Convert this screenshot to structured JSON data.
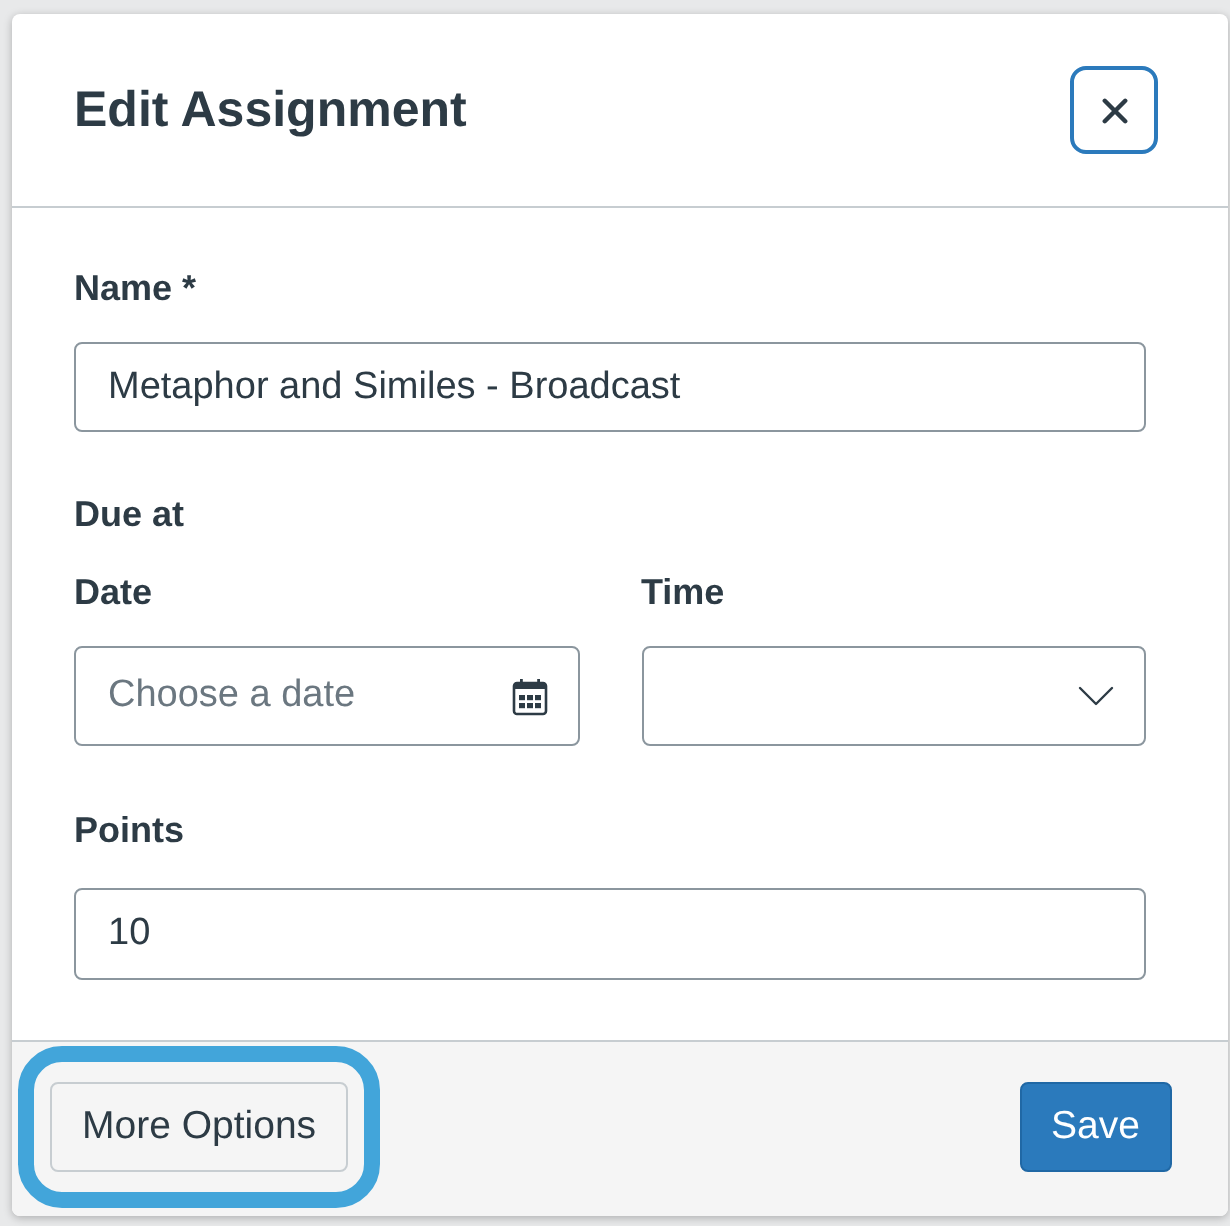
{
  "dialog": {
    "title": "Edit Assignment",
    "close_button": {
      "focused": true
    }
  },
  "name_field": {
    "label": "Name *",
    "value": "Metaphor and Similes - Broadcast"
  },
  "due_at": {
    "heading": "Due at",
    "date": {
      "label": "Date",
      "placeholder": "Choose a date"
    },
    "time": {
      "label": "Time"
    }
  },
  "points_field": {
    "label": "Points",
    "value": "10"
  },
  "footer": {
    "buttons": [
      {
        "label": "More Options",
        "kind": "secondary",
        "highlighted": true
      },
      {
        "label": "Save",
        "kind": "primary",
        "highlighted": false
      }
    ]
  }
}
